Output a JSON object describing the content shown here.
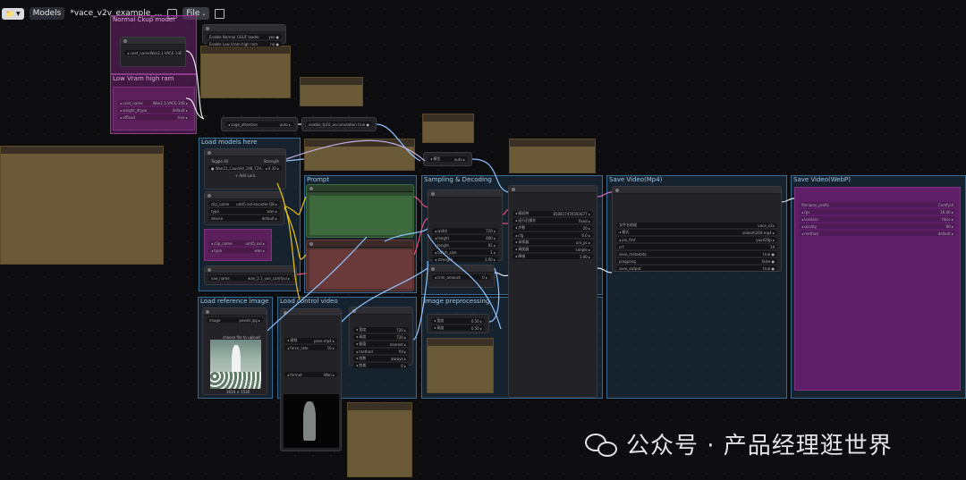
{
  "topbar": {
    "folder_icon": "folder-icon",
    "models_label": "Models",
    "workflow_title": "*vace_v2v_example_...",
    "file_label": "File",
    "save_icon": "save-icon",
    "image_icon": "image-icon"
  },
  "groups": {
    "normal_ckup": "Normal Ckup model",
    "low_vram": "Low Vram high ram",
    "load_models": "Load models here",
    "prompt": "Prompt",
    "sampling": "Sampling & Decoding",
    "save_mp4": "Save Video(Mp4)",
    "save_webp": "Save Video(WebP)",
    "load_reference": "Load reference image",
    "load_control": "Load control video",
    "image_pre": "Image preprocessing"
  },
  "node_text": {
    "enable_block_swap": "Enable Normal GGUF loader",
    "enable_low_vram": "Enable Low Vram high ram",
    "lora_name": "lora_name",
    "add_lora": "+ Add Lora",
    "toggle_all": "Toggle All",
    "strength": "Strength",
    "clip_name": "clip_name",
    "type": "type",
    "device": "device",
    "vae_name": "vae_name",
    "image_label": "image",
    "upload_label": "choose file to upload",
    "image_size": "1024 × 1536"
  },
  "watermark": {
    "text": "公众号 · 产品经理逛世界",
    "icon": "wechat-icon"
  },
  "colors": {
    "group_blue": "#3a6a8e",
    "group_purple": "#8a3c8a",
    "note_brown": "#6b5a37",
    "prompt_positive": "#3d6a3d",
    "prompt_negative": "#6a3a3a",
    "wire_yellow": "#e8c31a",
    "wire_pink": "#e84d7a",
    "wire_blue": "#8fc4ff",
    "wire_purple": "#d070d0"
  }
}
